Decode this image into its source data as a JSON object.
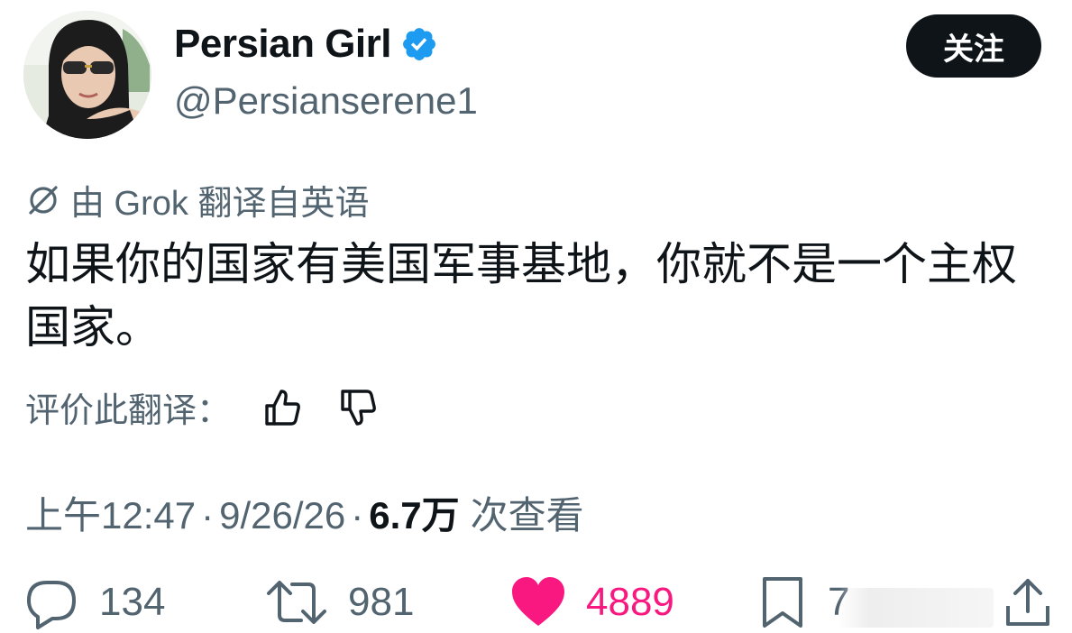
{
  "user": {
    "display_name": "Persian Girl",
    "handle": "@Persianserene1",
    "verified": true,
    "avatar_icon": "profile-photo"
  },
  "follow_button": {
    "label": "关注"
  },
  "translation": {
    "icon": "grok-icon",
    "label": "由 Grok 翻译自英语"
  },
  "tweet": {
    "text": "如果你的国家有美国军事基地，你就不是一个主权国家。"
  },
  "rate_translation": {
    "label": "评价此翻译：",
    "up_icon": "thumbs-up-icon",
    "down_icon": "thumbs-down-icon"
  },
  "meta": {
    "time": "上午12:47",
    "separator": "·",
    "date": "9/26/26",
    "views": "6.7万",
    "views_label": "次查看"
  },
  "actions": {
    "reply": {
      "icon": "reply-icon",
      "count": "134"
    },
    "retweet": {
      "icon": "retweet-icon",
      "count": "981"
    },
    "like": {
      "icon": "heart-icon",
      "count": "4889",
      "liked": true
    },
    "bookmark": {
      "icon": "bookmark-icon",
      "count": "7"
    },
    "share": {
      "icon": "share-icon"
    }
  },
  "colors": {
    "text": "#0f1419",
    "secondary": "#536471",
    "verified": "#1d9bf0",
    "like": "#f91880",
    "button_bg": "#0f1419"
  }
}
